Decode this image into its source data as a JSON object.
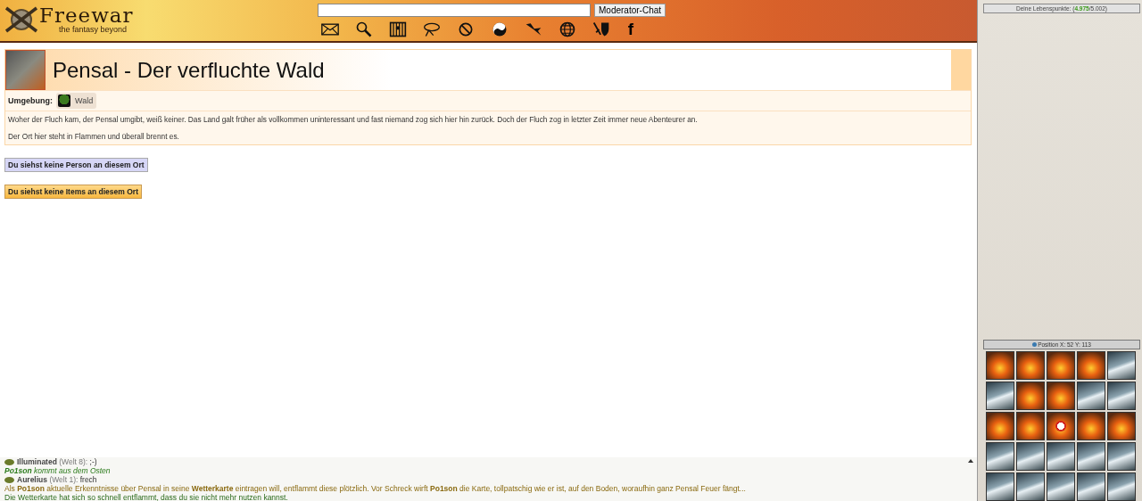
{
  "header": {
    "logo": {
      "title": "Freewar",
      "tagline": "the fantasy beyond"
    },
    "chat_button": "Moderator-Chat",
    "icons": [
      {
        "kind": "envelope"
      },
      {
        "kind": "search"
      },
      {
        "kind": "jail"
      },
      {
        "kind": "lasso"
      },
      {
        "kind": "prohibited"
      },
      {
        "kind": "yinyang"
      },
      {
        "kind": "bird"
      },
      {
        "kind": "globe"
      },
      {
        "kind": "swordshield"
      },
      {
        "kind": "facebook",
        "glyph": "f"
      }
    ]
  },
  "place": {
    "title": "Pensal - Der verfluchte Wald",
    "environment_label": "Umgebung:",
    "environment": "Wald",
    "description": [
      "Woher der Fluch kam, der Pensal umgibt, weiß keiner. Das Land galt früher als vollkommen uninteressant und fast niemand zog sich hier hin zurück. Doch der Fluch zog in letzter Zeit immer neue Abenteurer an.",
      "Der Ort hier steht in Flammen und überall brennt es."
    ]
  },
  "panels": [
    {
      "kind": "persons",
      "label": "Du siehst keine Person an diesem Ort"
    },
    {
      "kind": "items",
      "label": "Du siehst keine Items an diesem Ort"
    }
  ],
  "chat": [
    {
      "kind": "player",
      "name": "Illuminated",
      "meta": " (Welt 8): ",
      "text": ";-)"
    },
    {
      "kind": "movement",
      "text": "**Po1son** kommt aus dem Osten"
    },
    {
      "kind": "player",
      "name": "Aurelius",
      "meta": " (Welt 1): ",
      "text": "frech"
    },
    {
      "kind": "event",
      "text": "Als **Po1son** aktuelle Erkenntnisse über Pensal in seine **Wetterkarte** eintragen will, entflammt diese plötzlich. Vor Schreck wirft **Po1son** die Karte, tollpatschig wie er ist, auf den Boden, woraufhin ganz Pensal Feuer fängt..."
    },
    {
      "kind": "info",
      "text": "Die Wetterkarte hat sich so schnell entflammt, dass du sie nicht mehr nutzen kannst."
    }
  ],
  "sidebar": {
    "health": {
      "label": "Deine Lebenspunkte: (",
      "current": "4.975",
      "separator": "/",
      "max": "5.002",
      "end": ")"
    },
    "position": "Position X: 52 Y: 113",
    "map": [
      [
        {
          "kind": "fire",
          "current": false
        },
        {
          "kind": "fire",
          "current": false
        },
        {
          "kind": "fire",
          "current": false
        },
        {
          "kind": "fire",
          "current": false
        },
        {
          "kind": "snow",
          "current": false
        }
      ],
      [
        {
          "kind": "snow",
          "current": false
        },
        {
          "kind": "fire",
          "current": false
        },
        {
          "kind": "fire",
          "current": false
        },
        {
          "kind": "snow",
          "current": false
        },
        {
          "kind": "snow",
          "current": false
        }
      ],
      [
        {
          "kind": "fire",
          "current": false
        },
        {
          "kind": "fire",
          "current": false
        },
        {
          "kind": "fire",
          "current": true
        },
        {
          "kind": "fire",
          "current": false
        },
        {
          "kind": "fire",
          "current": false
        }
      ],
      [
        {
          "kind": "snow",
          "current": false
        },
        {
          "kind": "snow",
          "current": false
        },
        {
          "kind": "snow",
          "current": false
        },
        {
          "kind": "snow",
          "current": false
        },
        {
          "kind": "snow",
          "current": false
        }
      ],
      [
        {
          "kind": "snow",
          "current": false
        },
        {
          "kind": "snow",
          "current": false
        },
        {
          "kind": "snow",
          "current": false
        },
        {
          "kind": "snow",
          "current": false
        },
        {
          "kind": "snow",
          "current": false
        }
      ]
    ]
  }
}
